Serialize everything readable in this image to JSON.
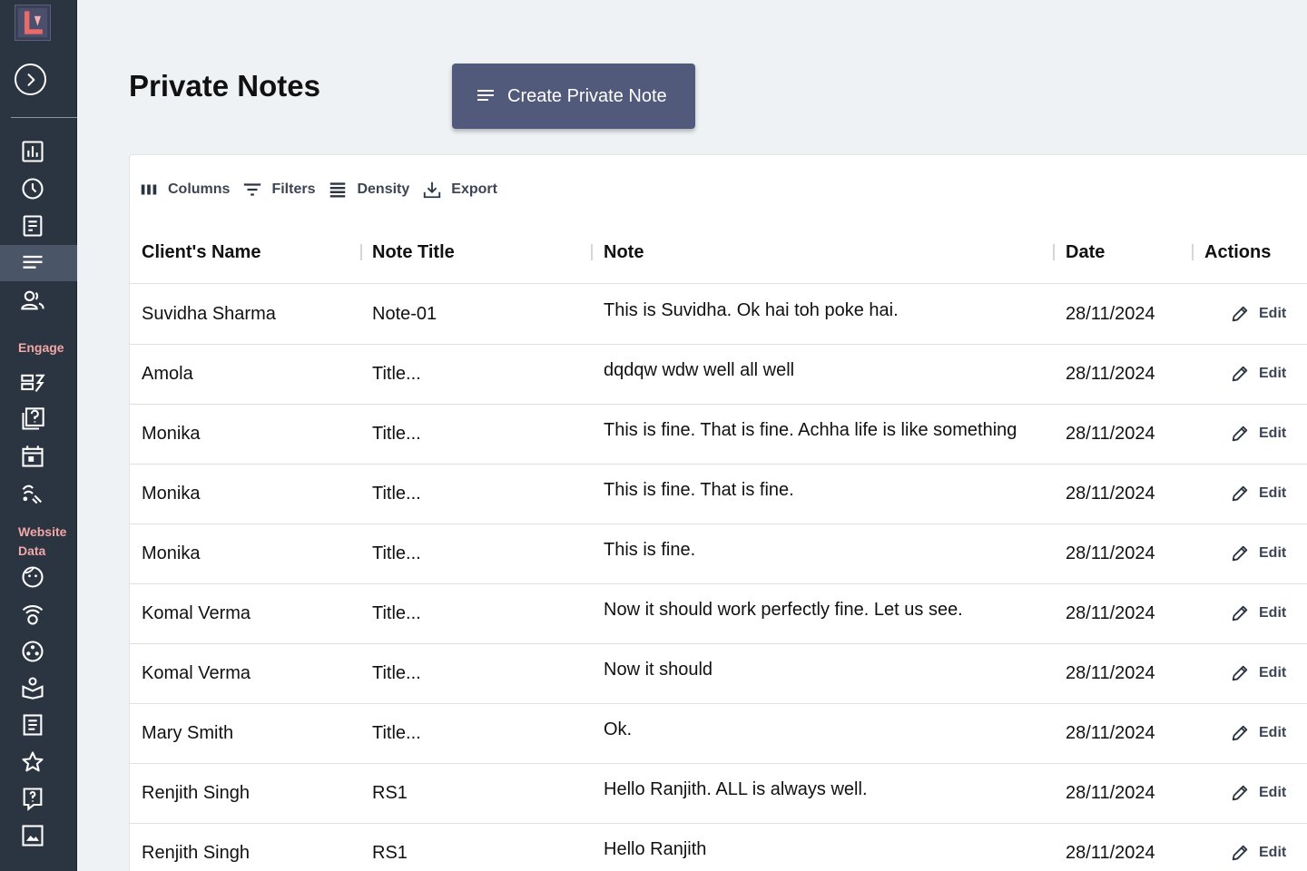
{
  "sidebar": {
    "sections": [
      {
        "label": "Engage"
      },
      {
        "label": "Website Data"
      }
    ],
    "icons": [
      "analytics-icon",
      "history-icon",
      "form-icon",
      "notes-icon",
      "clients-icon",
      "campaign-icon",
      "quiz-icon",
      "calendar-icon",
      "automation-icon",
      "visitor-icon",
      "broadcast-icon",
      "integrations-icon",
      "courses-icon",
      "articles-icon",
      "reviews-icon",
      "faq-icon",
      "gallery-icon"
    ],
    "active_item": "notes-icon",
    "accent_label_color": "#f2a7a7",
    "background_color": "#2b3441"
  },
  "header": {
    "title": "Private Notes",
    "create_button": "Create Private Note",
    "create_button_color": "#525a7c"
  },
  "toolbar": {
    "columns": "Columns",
    "filters": "Filters",
    "density": "Density",
    "export": "Export"
  },
  "table": {
    "columns": [
      "Client's Name",
      "Note Title",
      "Note",
      "Date",
      "Actions"
    ],
    "edit_label": "Edit",
    "rows": [
      {
        "name": "Suvidha  Sharma",
        "title": "Note-01",
        "note": "This is Suvidha. Ok hai toh poke hai.",
        "date": "28/11/2024"
      },
      {
        "name": "Amola",
        "title": "Title...",
        "note": "dqdqw wdw well all well",
        "date": "28/11/2024"
      },
      {
        "name": "Monika",
        "title": "Title...",
        "note": "This is fine. That is fine. Achha life is like something",
        "date": "28/11/2024"
      },
      {
        "name": "Monika",
        "title": "Title...",
        "note": "This is fine. That is fine.",
        "date": "28/11/2024"
      },
      {
        "name": "Monika",
        "title": "Title...",
        "note": "This is fine.",
        "date": "28/11/2024"
      },
      {
        "name": "Komal Verma",
        "title": "Title...",
        "note": "Now it should work perfectly fine. Let us see.",
        "date": "28/11/2024"
      },
      {
        "name": "Komal Verma",
        "title": "Title...",
        "note": "Now it should",
        "date": "28/11/2024"
      },
      {
        "name": "Mary Smith",
        "title": "Title...",
        "note": "Ok.",
        "date": "28/11/2024"
      },
      {
        "name": "Renjith Singh",
        "title": "RS1",
        "note": "Hello Ranjith. ALL is always well.",
        "date": "28/11/2024"
      },
      {
        "name": "Renjith Singh",
        "title": "RS1",
        "note": "Hello Ranjith",
        "date": "28/11/2024"
      }
    ]
  }
}
